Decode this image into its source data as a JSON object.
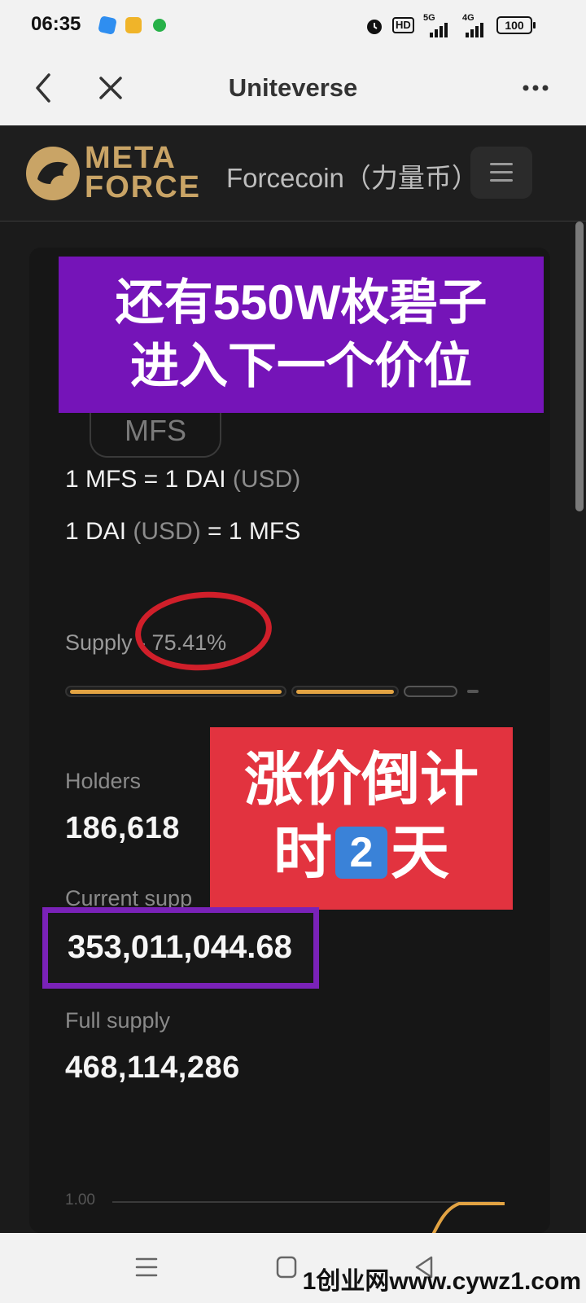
{
  "status_bar": {
    "time": "06:35",
    "network_hd": "HD",
    "network_5g": "5G",
    "network_4g": "4G",
    "battery": "100"
  },
  "browser": {
    "title": "Uniteverse"
  },
  "site": {
    "logo_line1": "META",
    "logo_line2": "FORCE",
    "name": "Forcecoin（力量币）"
  },
  "card": {
    "badge": "MFS",
    "rate1_main": "1 MFS = 1 DAI",
    "rate1_unit": "(USD)",
    "rate2_main": "1 DAI",
    "rate2_unit": "(USD)",
    "rate2_tail": "= 1 MFS",
    "supply_label": "Supply - 75.41%",
    "supply_progress": 0.7541,
    "holders_label": "Holders",
    "holders_value": "186,618",
    "current_supply_label": "Current supp",
    "current_supply_value": "353,011,044.68",
    "full_supply_label": "Full supply",
    "full_supply_value": "468,114,286",
    "chart_tick": "1.00"
  },
  "overlays": {
    "purple_line1": "还有550W枚碧子",
    "purple_line2": "进入下一个价位",
    "red_line1": "涨价倒计",
    "red_line2_pre": "时",
    "red_digit": "2",
    "red_line2_post": "天"
  },
  "watermark": "1创业网www.cywz1.com",
  "colors": {
    "accent_gold": "#e2a343",
    "logo_gold": "#c9a466",
    "purple_overlay": "#7514b8",
    "red_overlay": "#e2333f",
    "red_circle": "#d01f2a"
  },
  "icons": {
    "back": "chevron-left-icon",
    "close": "close-icon",
    "more": "more-horizontal-icon",
    "menu": "hamburger-menu-icon"
  }
}
